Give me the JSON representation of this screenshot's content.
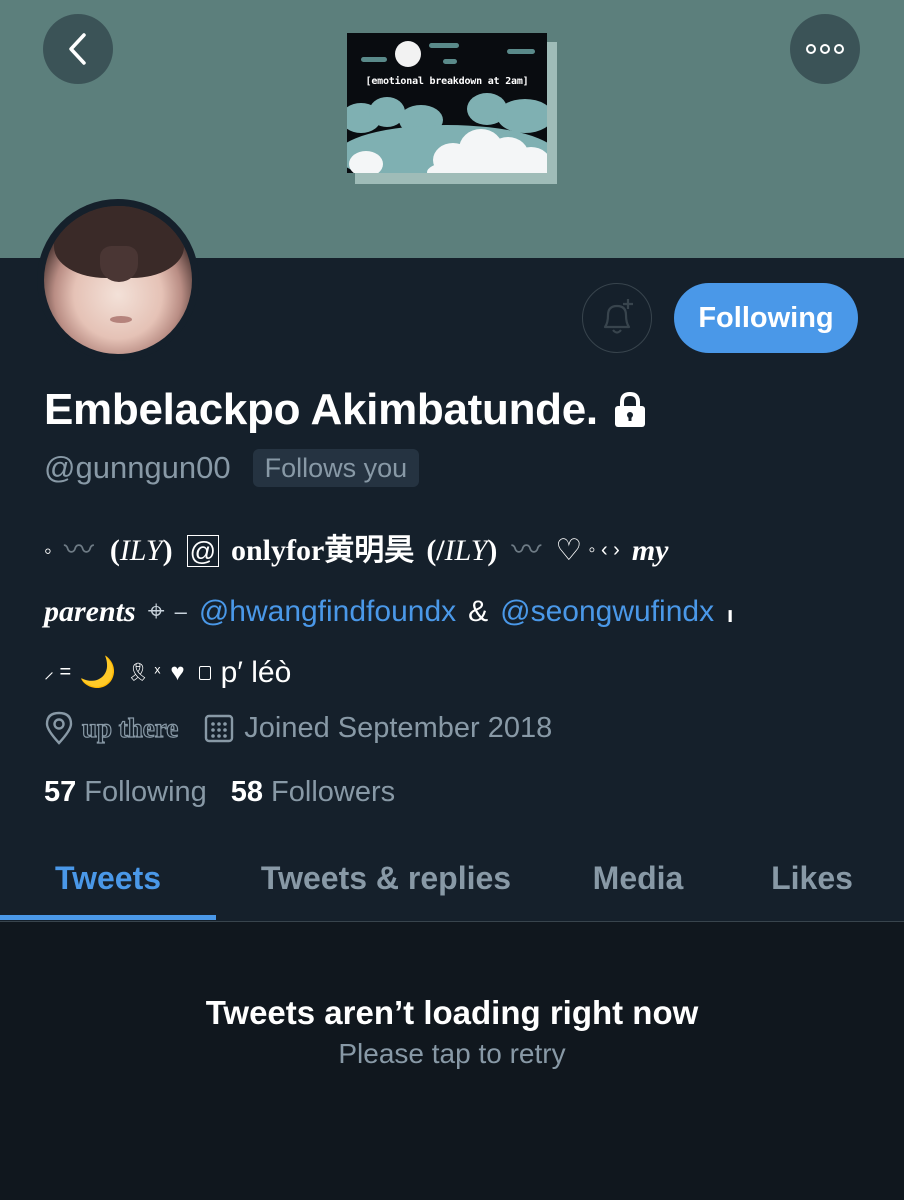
{
  "header": {
    "back_icon": "chevron-left-icon",
    "more_icon": "more-dots-icon",
    "banner_text": "[emotional breakdown at 2am]"
  },
  "profile": {
    "display_name": "Embelackpo Akimbatunde.",
    "handle": "@gunngun00",
    "follows_you": "Follows you",
    "following_button": "Following",
    "notify_icon": "bell-plus-icon",
    "lock_icon": "lock-icon"
  },
  "bio": {
    "line1": {
      "a": "◦",
      "b": "〰",
      "c": "(",
      "d": "ILY",
      "e": ")",
      "f": "@",
      "g": "onlyfor黄明昊",
      "h": "(/",
      "i": "ILY",
      "j": ")",
      "k": "〰",
      "l": "♡",
      "m": "◦ ‹ ›",
      "n": "my"
    },
    "line2": {
      "a": "parents",
      "b": "⌖",
      "c": "–",
      "mention1": "@hwangfindfoundx",
      "amp": "&",
      "mention2": "@seongwufindx",
      "d": "╻"
    },
    "line3": {
      "a": "⸝ =",
      "moon": "🌙",
      "b": "🎗 ˣ",
      "heart": "♥",
      "c": "p′ léò"
    }
  },
  "meta": {
    "location_icon": "location-pin-icon",
    "location": "up there",
    "calendar_icon": "calendar-icon",
    "joined": "Joined September 2018"
  },
  "counts": {
    "following_count": "57",
    "following_label": "Following",
    "followers_count": "58",
    "followers_label": "Followers"
  },
  "tabs": [
    "Tweets",
    "Tweets & replies",
    "Media",
    "Likes"
  ],
  "active_tab": "Tweets",
  "error": {
    "title": "Tweets aren’t loading right now",
    "subtitle": "Please tap to retry"
  },
  "colors": {
    "background": "#15202b",
    "banner": "#5c7f7c",
    "accent": "#4a98e8",
    "secondary_text": "#8899a6"
  }
}
